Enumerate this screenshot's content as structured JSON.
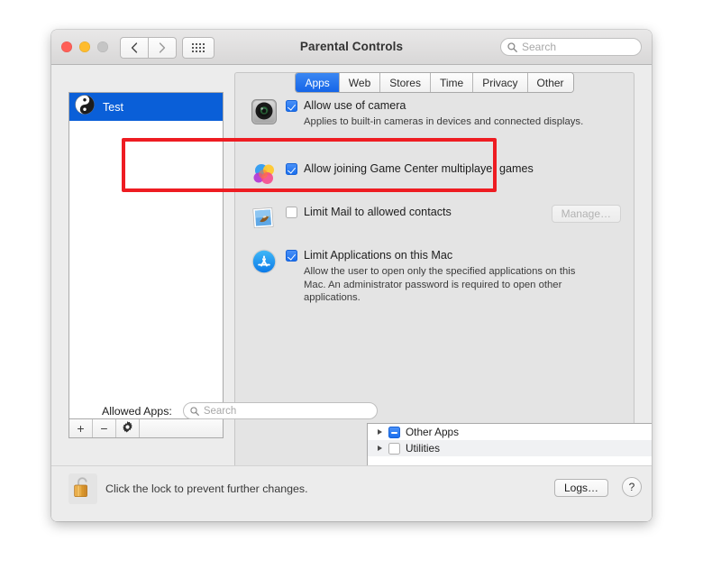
{
  "window": {
    "title": "Parental Controls",
    "traffic_lights": [
      "close-button",
      "minimize-button",
      "zoom-button"
    ],
    "nav": {
      "back_icon": "chevron-left-icon",
      "forward_icon": "chevron-right-icon",
      "grid_icon": "show-all-icon"
    },
    "search": {
      "placeholder": "Search",
      "value": "",
      "icon": "search-icon"
    }
  },
  "tabs": [
    {
      "label": "Apps",
      "active": true
    },
    {
      "label": "Web",
      "active": false
    },
    {
      "label": "Stores",
      "active": false
    },
    {
      "label": "Time",
      "active": false
    },
    {
      "label": "Privacy",
      "active": false
    },
    {
      "label": "Other",
      "active": false
    }
  ],
  "sidebar": {
    "users": [
      {
        "name": "Test",
        "avatar_icon": "yin-yang-avatar-icon",
        "selected": true
      }
    ],
    "toolbar": [
      {
        "label": "+",
        "name": "add-user-button"
      },
      {
        "label": "−",
        "name": "remove-user-button"
      },
      {
        "label": "⚙",
        "name": "gear-action-button"
      }
    ]
  },
  "options": [
    {
      "name": "allow-camera",
      "icon": "camera-icon",
      "label": "Allow use of camera",
      "sublabel": "Applies to built-in cameras in devices and connected displays.",
      "checked": true,
      "highlighted": true
    },
    {
      "name": "allow-game-center",
      "icon": "game-center-icon",
      "label": "Allow joining Game Center multiplayer games",
      "sublabel": "",
      "checked": true,
      "highlighted": false
    },
    {
      "name": "limit-mail",
      "icon": "mail-photo-icon",
      "label": "Limit Mail to allowed contacts",
      "sublabel": "",
      "checked": false,
      "highlighted": false,
      "button": {
        "label": "Manage…",
        "disabled": true
      }
    },
    {
      "name": "limit-applications",
      "icon": "app-store-icon",
      "label": "Limit Applications on this Mac",
      "sublabel": "Allow the user to open only the specified applications on this Mac. An administrator password is required to open other applications.",
      "checked": true,
      "highlighted": false
    }
  ],
  "allowed_apps": {
    "label": "Allowed Apps:",
    "search": {
      "placeholder": "Search",
      "value": "",
      "icon": "search-icon"
    },
    "rows": [
      {
        "name": "Other Apps",
        "state": "mixed",
        "expandable": true
      },
      {
        "name": "Utilities",
        "state": "off",
        "expandable": true
      }
    ]
  },
  "bottom_bar": {
    "lock_icon": "unlocked-padlock-icon",
    "lock_text": "Click the lock to prevent further changes.",
    "logs_label": "Logs…",
    "help_label": "?"
  },
  "colors": {
    "accent_blue": "#1b6fee",
    "selection_blue": "#0a5fd8",
    "highlight_red": "#ee1c22",
    "window_bg": "#ececec",
    "panel_bg": "#e4e4e4"
  }
}
